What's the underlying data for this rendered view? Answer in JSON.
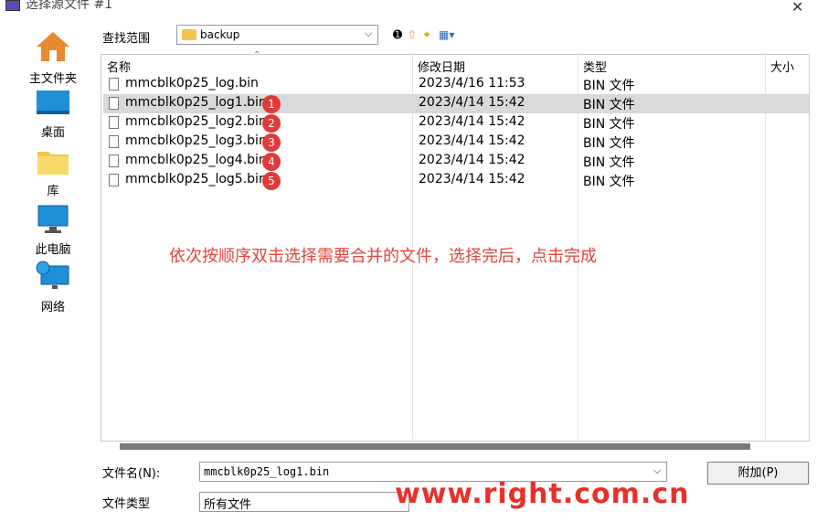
{
  "window": {
    "title": "选择源文件 #1"
  },
  "places": [
    {
      "label": "主文件夹",
      "icon": "home-icon"
    },
    {
      "label": "桌面",
      "icon": "desktop-icon"
    },
    {
      "label": "库",
      "icon": "library-folder-icon"
    },
    {
      "label": "此电脑",
      "icon": "computer-icon"
    },
    {
      "label": "网络",
      "icon": "network-icon"
    }
  ],
  "lookin": {
    "label": "查找范围",
    "value": "backup"
  },
  "columns": {
    "name": "名称",
    "date": "修改日期",
    "type": "类型",
    "size": "大小"
  },
  "files": [
    {
      "name": "mmcblk0p25_log.bin",
      "date": "2023/4/16 11:53",
      "type": "BIN 文件",
      "badge": ""
    },
    {
      "name": "mmcblk0p25_log1.bin",
      "date": "2023/4/14 15:42",
      "type": "BIN 文件",
      "badge": "1"
    },
    {
      "name": "mmcblk0p25_log2.bin",
      "date": "2023/4/14 15:42",
      "type": "BIN 文件",
      "badge": "2"
    },
    {
      "name": "mmcblk0p25_log3.bin",
      "date": "2023/4/14 15:42",
      "type": "BIN 文件",
      "badge": "3"
    },
    {
      "name": "mmcblk0p25_log4.bin",
      "date": "2023/4/14 15:42",
      "type": "BIN 文件",
      "badge": "4"
    },
    {
      "name": "mmcblk0p25_log5.bin",
      "date": "2023/4/14 15:42",
      "type": "BIN 文件",
      "badge": "5"
    }
  ],
  "annotation": "依次按顺序双击选择需要合并的文件，选择完后，点击完成",
  "filename": {
    "label": "文件名(N):",
    "value": "mmcblk0p25_log1.bin"
  },
  "filetype": {
    "label": "文件类型",
    "value": "所有文件"
  },
  "buttons": {
    "add": "附加(P)"
  },
  "watermark": "www.right.com.cn",
  "colors": {
    "badge": "#e03a3a",
    "annotation": "#e0443a",
    "watermark": "#e8302a"
  }
}
